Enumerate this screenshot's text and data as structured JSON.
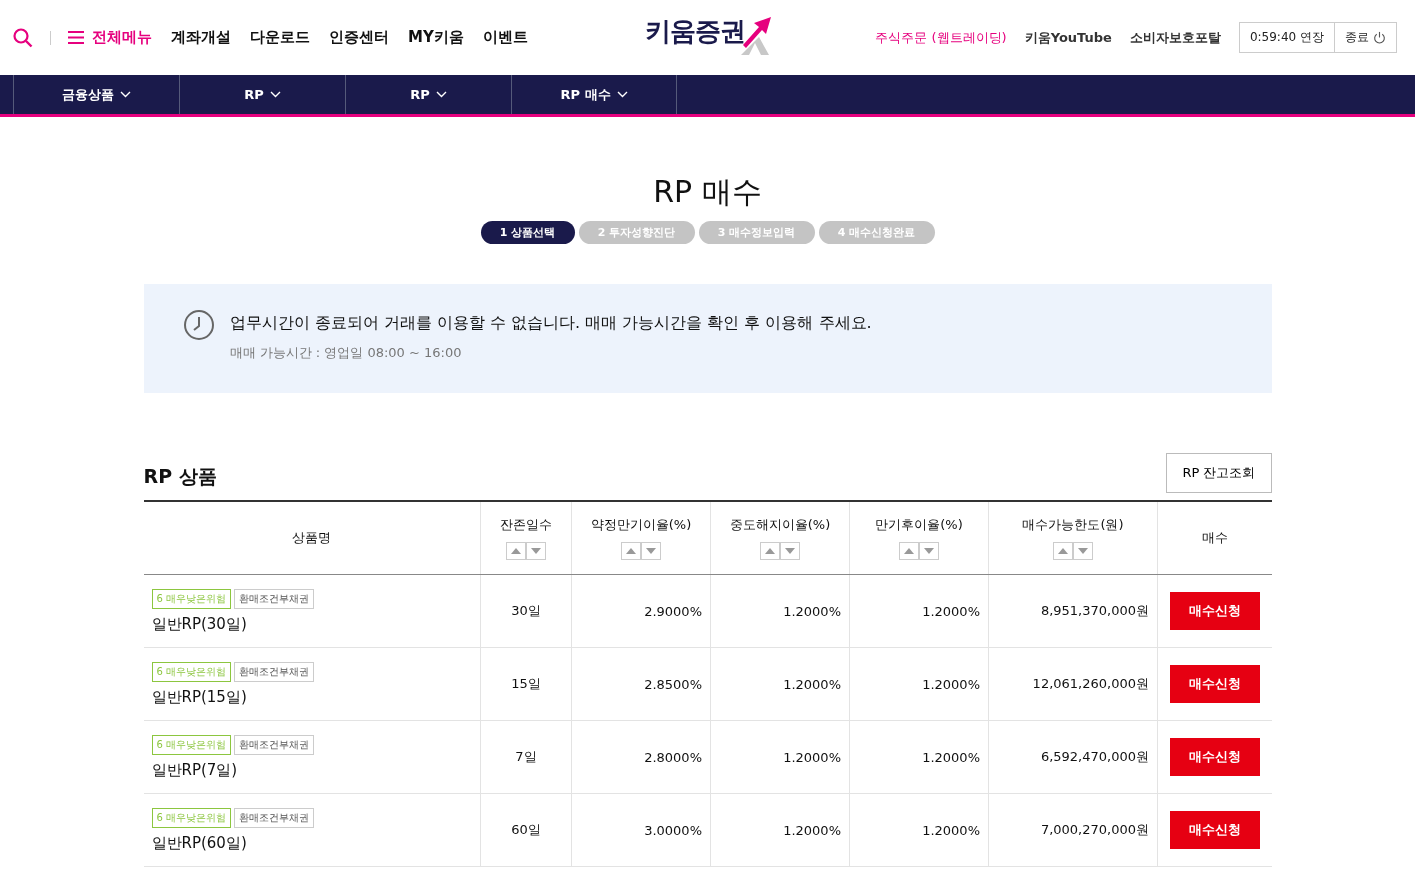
{
  "header": {
    "menu_label": "전체메뉴",
    "links": [
      "계좌개설",
      "다운로드",
      "인증센터",
      "MY키움",
      "이벤트"
    ],
    "logo": "키움증권",
    "right_links": [
      {
        "label": "주식주문 (웹트레이딩)",
        "kind": "accent"
      },
      {
        "label": "키움YouTube",
        "kind": "plain"
      },
      {
        "label": "소비자보호포탈",
        "kind": "plain"
      }
    ],
    "session_time": "0:59:40",
    "extend_label": "연장",
    "logout_label": "종료"
  },
  "breadcrumb": [
    "금융상품",
    "RP",
    "RP",
    "RP 매수"
  ],
  "page_title": "RP 매수",
  "steps": [
    {
      "label": "1 상품선택",
      "selected": true
    },
    {
      "label": "2 투자성향진단",
      "selected": false
    },
    {
      "label": "3 매수정보입력",
      "selected": false
    },
    {
      "label": "4 매수신청완료",
      "selected": false
    }
  ],
  "notice": {
    "message": "업무시간이 종료되어 거래를 이용할 수 없습니다. 매매 가능시간을 확인 후 이용해 주세요.",
    "hours": "매매 가능시간 : 영업일 08:00 ~ 16:00"
  },
  "section_title": "RP 상품",
  "balance_button": "RP 잔고조회",
  "table": {
    "columns": [
      {
        "label": "상품명",
        "sortable": false
      },
      {
        "label": "잔존일수",
        "sortable": true
      },
      {
        "label": "약정만기이율(%)",
        "sortable": true
      },
      {
        "label": "중도해지이율(%)",
        "sortable": true
      },
      {
        "label": "만기후이율(%)",
        "sortable": true
      },
      {
        "label": "매수가능한도(원)",
        "sortable": true
      },
      {
        "label": "매수",
        "sortable": false
      }
    ],
    "rows": [
      {
        "tags": [
          {
            "label": "6 매우낮은위험",
            "kind": "risk"
          },
          {
            "label": "환매조건부채권",
            "kind": "type"
          }
        ],
        "name": "일반RP(30일)",
        "days": "30일",
        "rate": "2.9000%",
        "early_rate": "1.2000%",
        "after_rate": "1.2000%",
        "limit": "8,951,370,000원",
        "action": "매수신청"
      },
      {
        "tags": [
          {
            "label": "6 매우낮은위험",
            "kind": "risk"
          },
          {
            "label": "환매조건부채권",
            "kind": "type"
          }
        ],
        "name": "일반RP(15일)",
        "days": "15일",
        "rate": "2.8500%",
        "early_rate": "1.2000%",
        "after_rate": "1.2000%",
        "limit": "12,061,260,000원",
        "action": "매수신청"
      },
      {
        "tags": [
          {
            "label": "6 매우낮은위험",
            "kind": "risk"
          },
          {
            "label": "환매조건부채권",
            "kind": "type"
          }
        ],
        "name": "일반RP(7일)",
        "days": "7일",
        "rate": "2.8000%",
        "early_rate": "1.2000%",
        "after_rate": "1.2000%",
        "limit": "6,592,470,000원",
        "action": "매수신청"
      },
      {
        "tags": [
          {
            "label": "6 매우낮은위험",
            "kind": "risk"
          },
          {
            "label": "환매조건부채권",
            "kind": "type"
          }
        ],
        "name": "일반RP(60일)",
        "days": "60일",
        "rate": "3.0000%",
        "early_rate": "1.2000%",
        "after_rate": "1.2000%",
        "limit": "7,000,270,000원",
        "action": "매수신청"
      }
    ]
  }
}
